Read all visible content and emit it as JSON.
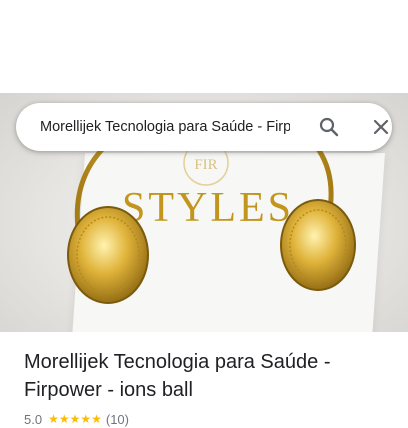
{
  "search": {
    "query": "Morellijek Tecnologia para Saúde - Firpower - ions ball"
  },
  "image": {
    "brand_text": "STYLES",
    "emblem_text": "FIR"
  },
  "place": {
    "title": "Morellijek Tecnologia para Saúde - Firpower - ions ball",
    "rating": "5.0",
    "stars_glyph": "★★★★★",
    "review_count": "(10)"
  },
  "icons": {
    "search": "search-icon",
    "close": "close-icon"
  },
  "colors": {
    "star": "#fbbc04",
    "gold": "#d4a017",
    "icon_gray": "#5f6368"
  }
}
